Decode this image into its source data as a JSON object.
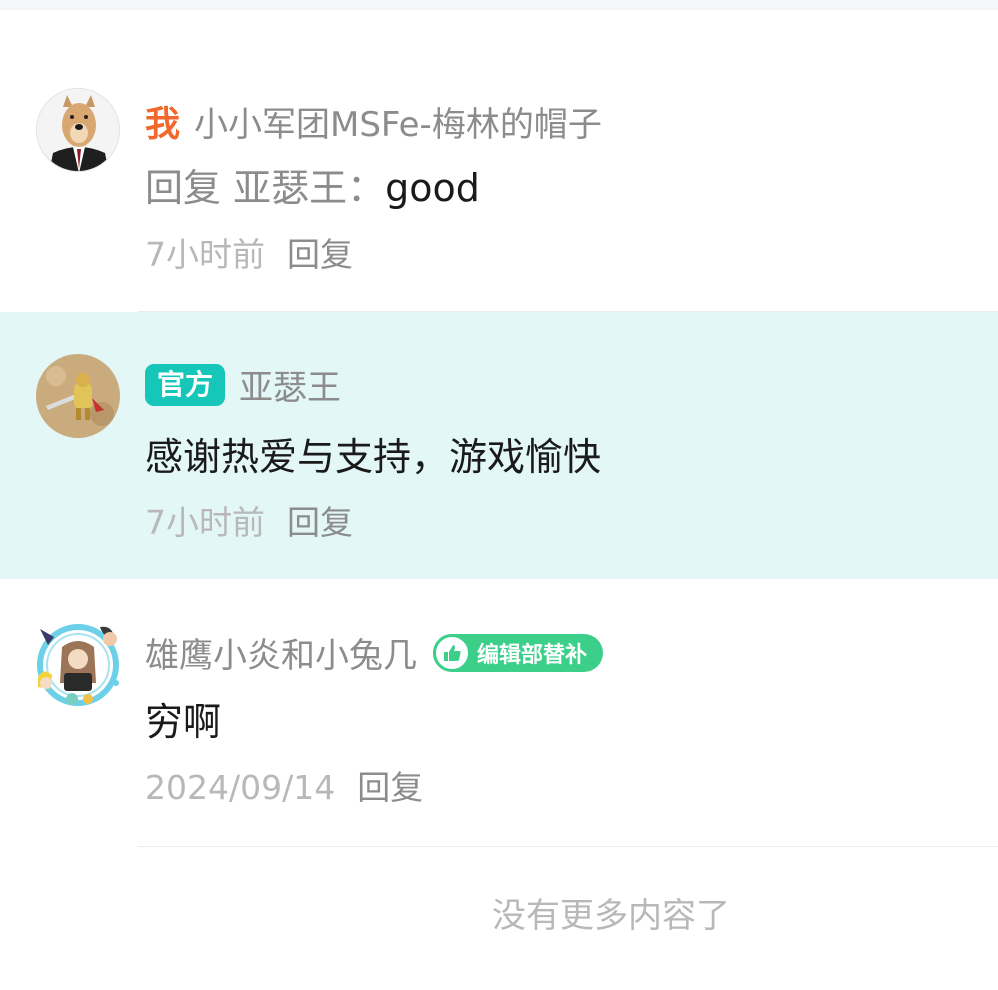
{
  "comments": [
    {
      "me_label": "我",
      "username": "小小军团MSFe-梅林的帽子",
      "reply_prefix": "回复 亚瑟王：",
      "content": "good",
      "time": "7小时前",
      "reply_label": "回复"
    },
    {
      "tag": "官方",
      "username": "亚瑟王",
      "content": "感谢热爱与支持，游戏愉快",
      "time": "7小时前",
      "reply_label": "回复"
    },
    {
      "username": "雄鹰小炎和小兔几",
      "badge": "编辑部替补",
      "content": "穷啊",
      "time": "2024/09/14",
      "reply_label": "回复"
    }
  ],
  "footer": {
    "end_text": "没有更多内容了"
  },
  "colors": {
    "accent_me": "#f2672a",
    "official_tag": "#16c7b9",
    "badge_green": "#3ccf8a",
    "highlight_bg": "#e3f7f7"
  }
}
